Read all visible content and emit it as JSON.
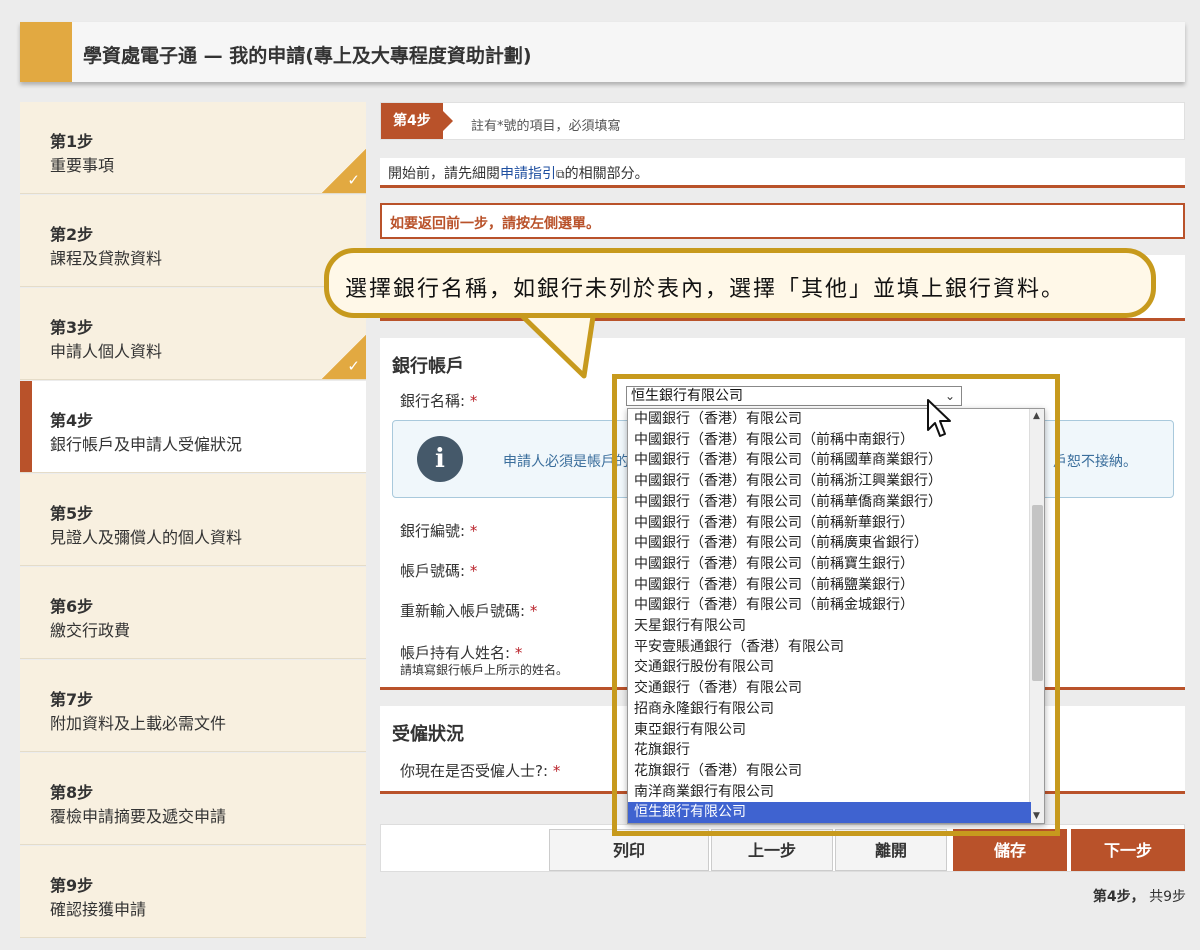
{
  "header": {
    "title": "學資處電子通 — 我的申請(專上及大專程度資助計劃)"
  },
  "sidebar": {
    "steps": [
      {
        "num": "第1步",
        "label": "重要事項",
        "done": true
      },
      {
        "num": "第2步",
        "label": "課程及貸款資料",
        "done": false
      },
      {
        "num": "第3步",
        "label": "申請人個人資料",
        "done": true
      },
      {
        "num": "第4步",
        "label": "銀行帳戶及申請人受僱狀況",
        "done": false,
        "active": true
      },
      {
        "num": "第5步",
        "label": "見證人及彌償人的個人資料",
        "done": false
      },
      {
        "num": "第6步",
        "label": "繳交行政費",
        "done": false
      },
      {
        "num": "第7步",
        "label": "附加資料及上載必需文件",
        "done": false
      },
      {
        "num": "第8步",
        "label": "覆檢申請摘要及遞交申請",
        "done": false
      },
      {
        "num": "第9步",
        "label": "確認接獲申請",
        "done": false
      }
    ],
    "check_glyph": "✓"
  },
  "stepbar": {
    "tag": "第4步",
    "note": "註有*號的項目，必須填寫"
  },
  "guide": {
    "before": "開始前，請先細閱",
    "link": "申請指引",
    "after": "的相關部分。"
  },
  "back_notice": "如要返回前一步，請按左側選單。",
  "callout": "選擇銀行名稱，如銀行未列於表內，選擇「其他」並填上銀行資料。",
  "bank": {
    "title": "銀行帳戶",
    "bank_name_label": "銀行名稱:",
    "selected": "恒生銀行有限公司",
    "info_text": "申請人必須是帳戶的",
    "info_text_end": "戶恕不接納。",
    "bank_code_label": "銀行編號:",
    "account_label": "帳戶號碼:",
    "account_confirm_label": "重新輸入帳戶號碼:",
    "holder_label": "帳戶持有人姓名:",
    "holder_hint": "請填寫銀行帳戶上所示的姓名。",
    "req": "*"
  },
  "status": {
    "title": "受僱狀況",
    "question": "你現在是否受僱人士?:"
  },
  "dropdown": {
    "options": [
      "中國銀行（香港）有限公司",
      "中國銀行（香港）有限公司（前稱中南銀行）",
      "中國銀行（香港）有限公司（前稱國華商業銀行）",
      "中國銀行（香港）有限公司（前稱浙江興業銀行）",
      "中國銀行（香港）有限公司（前稱華僑商業銀行）",
      "中國銀行（香港）有限公司（前稱新華銀行）",
      "中國銀行（香港）有限公司（前稱廣東省銀行）",
      "中國銀行（香港）有限公司（前稱寶生銀行）",
      "中國銀行（香港）有限公司（前稱鹽業銀行）",
      "中國銀行（香港）有限公司（前稱金城銀行）",
      "天星銀行有限公司",
      "平安壹賬通銀行（香港）有限公司",
      "交通銀行股份有限公司",
      "交通銀行（香港）有限公司",
      "招商永隆銀行有限公司",
      "東亞銀行有限公司",
      "花旗銀行",
      "花旗銀行（香港）有限公司",
      "南洋商業銀行有限公司",
      "恒生銀行有限公司"
    ],
    "selected_index": 19
  },
  "buttons": {
    "print": "列印",
    "prev": "上一步",
    "leave": "離開",
    "save": "儲存",
    "next": "下一步"
  },
  "page": {
    "current": "第4步，",
    "total": "共9步"
  },
  "colors": {
    "accent": "#e2a941",
    "brand": "#b9522a",
    "callout_border": "#c79a1d",
    "selected_option": "#3f63d0"
  }
}
